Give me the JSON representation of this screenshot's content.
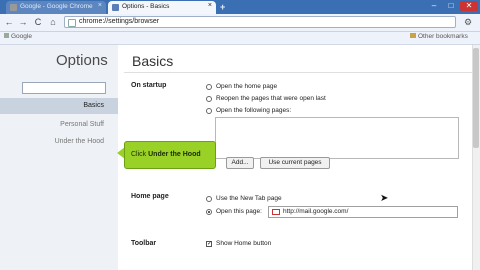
{
  "browser": {
    "tabs": [
      {
        "label": "Google - Google Chrome"
      },
      {
        "label": "Options - Basics"
      }
    ],
    "new_tab_label": "+",
    "address": "chrome://settings/browser",
    "bookmarks": [
      {
        "label": "Google"
      },
      {
        "label": "Other bookmarks"
      }
    ],
    "window_buttons": {
      "minimize": "–",
      "maximize": "□",
      "close": "✕"
    },
    "nav": {
      "back": "←",
      "forward": "→",
      "reload": "C",
      "home": "⌂",
      "wrench": "🔧"
    }
  },
  "sidebar": {
    "title": "Options",
    "items": [
      {
        "label": "Basics"
      },
      {
        "label": "Personal Stuff"
      },
      {
        "label": "Under the Hood"
      }
    ]
  },
  "main": {
    "title": "Basics",
    "startup": {
      "heading": "On startup",
      "options": [
        {
          "label": "Open the home page",
          "selected": false
        },
        {
          "label": "Reopen the pages that were open last",
          "selected": false
        },
        {
          "label": "Open the following pages:",
          "selected": false
        }
      ],
      "add_button": "Add...",
      "use_current_button": "Use current pages"
    },
    "homepage": {
      "heading": "Home page",
      "options": [
        {
          "label": "Use the New Tab page",
          "selected": false
        },
        {
          "label": "Open this page:",
          "selected": true
        }
      ],
      "url": "http://mail.google.com/"
    },
    "toolbar": {
      "heading": "Toolbar",
      "show_home_label": "Show Home button",
      "show_home_checked": true
    }
  },
  "tooltip": {
    "prefix": "Click ",
    "bold": "Under the Hood"
  },
  "colors": {
    "titlebar": "#3a6fb3",
    "tooltip": "#9ad126",
    "sidebar_selected": "#c9d2df"
  }
}
